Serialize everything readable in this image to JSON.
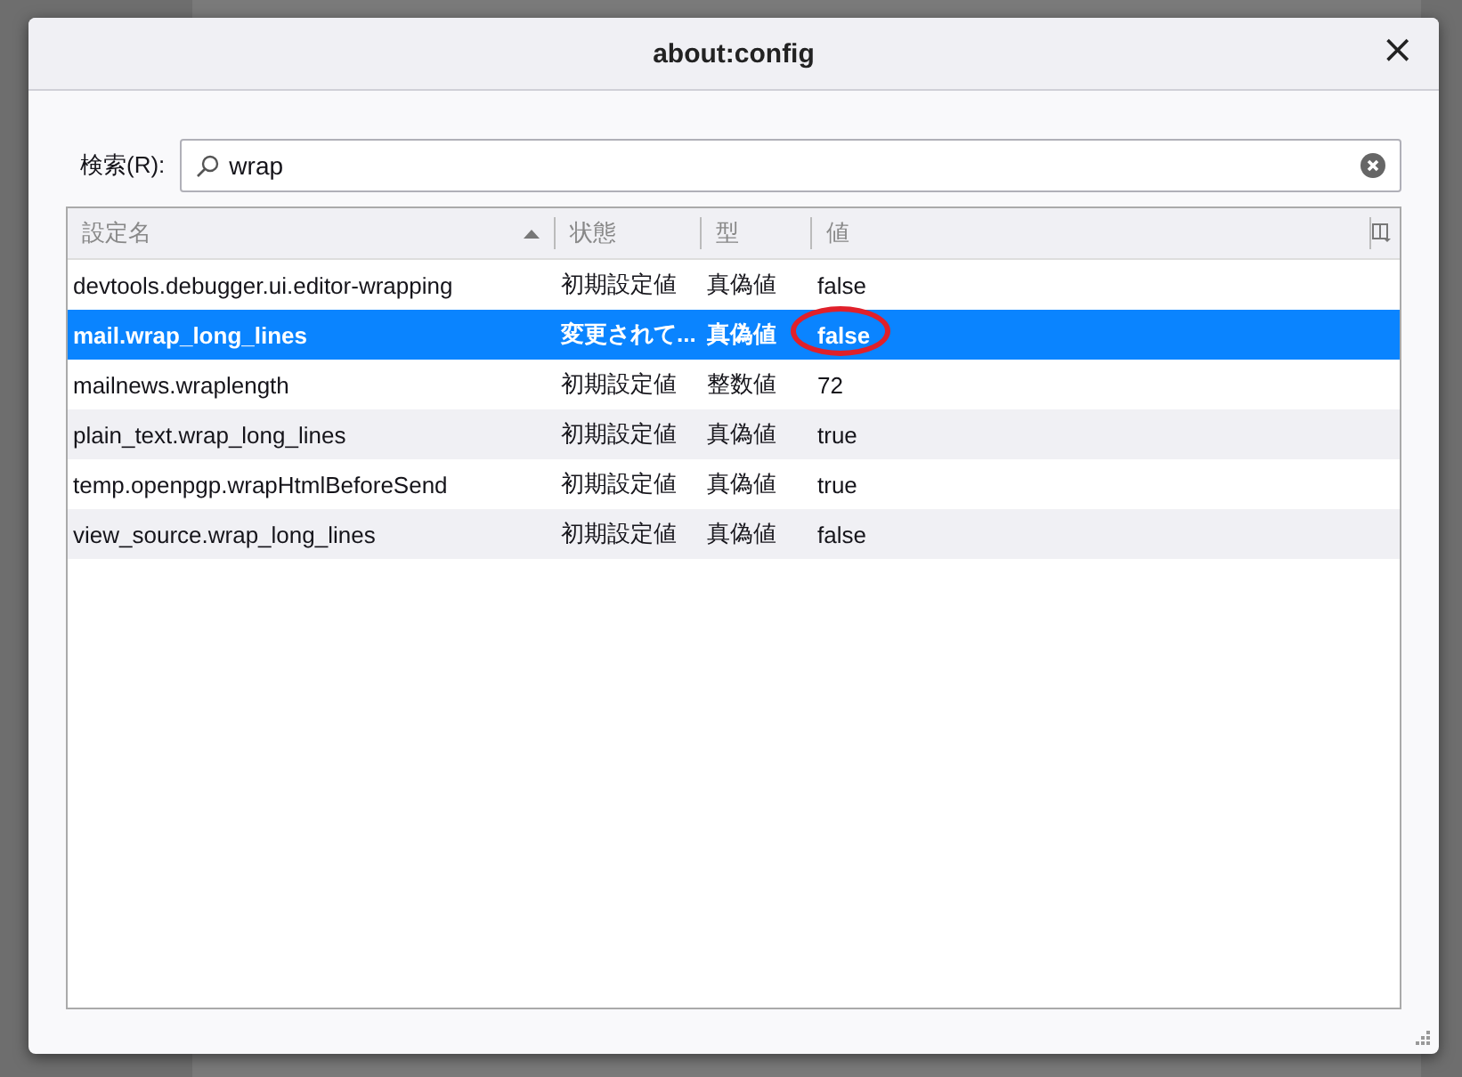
{
  "window": {
    "title": "about:config",
    "close": "×"
  },
  "search": {
    "label": "検索(R):",
    "value": "wrap"
  },
  "table": {
    "columns": [
      {
        "label": "設定名",
        "sorted": true
      },
      {
        "label": "状態",
        "sorted": false
      },
      {
        "label": "型",
        "sorted": false
      },
      {
        "label": "値",
        "sorted": false
      }
    ],
    "rows": [
      {
        "name": "devtools.debugger.ui.editor-wrapping",
        "status": "初期設定値",
        "type": "真偽値",
        "value": "false",
        "selected": false,
        "annotated": false
      },
      {
        "name": "mail.wrap_long_lines",
        "status": "変更されて...",
        "type": "真偽値",
        "value": "false",
        "selected": true,
        "annotated": true
      },
      {
        "name": "mailnews.wraplength",
        "status": "初期設定値",
        "type": "整数値",
        "value": "72",
        "selected": false,
        "annotated": false
      },
      {
        "name": "plain_text.wrap_long_lines",
        "status": "初期設定値",
        "type": "真偽値",
        "value": "true",
        "selected": false,
        "annotated": false
      },
      {
        "name": "temp.openpgp.wrapHtmlBeforeSend",
        "status": "初期設定値",
        "type": "真偽値",
        "value": "true",
        "selected": false,
        "annotated": false
      },
      {
        "name": "view_source.wrap_long_lines",
        "status": "初期設定値",
        "type": "真偽値",
        "value": "false",
        "selected": false,
        "annotated": false
      }
    ]
  }
}
